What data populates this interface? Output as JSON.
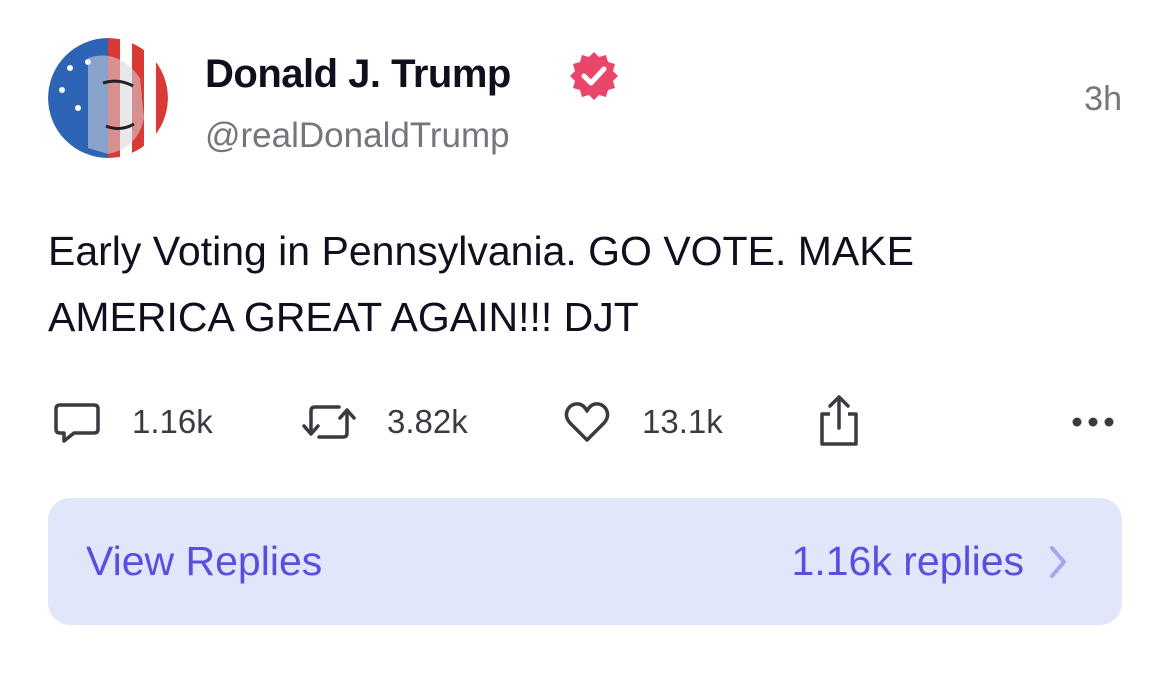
{
  "post": {
    "author_name": "Donald J. Trump",
    "handle": "@realDonaldTrump",
    "time": "3h",
    "text_line1": "Early Voting in Pennsylvania. GO VOTE. MAKE",
    "text_line2": "AMERICA GREAT AGAIN!!! DJT"
  },
  "actions": {
    "replies": "1.16k",
    "retruths": "3.82k",
    "likes": "13.1k"
  },
  "replies_bar": {
    "label": "View Replies",
    "count": "1.16k replies"
  },
  "icons": {
    "verified": "verified-badge-icon",
    "reply": "speech-bubble-icon",
    "retruth": "repost-arrows-icon",
    "like": "heart-icon",
    "share": "share-upload-icon",
    "more": "ellipsis-icon",
    "chevron": "chevron-right-icon"
  },
  "colors": {
    "accent": "#5b4de0",
    "verified": "#e9466a",
    "replies_bar_bg": "#e2e6fb"
  }
}
